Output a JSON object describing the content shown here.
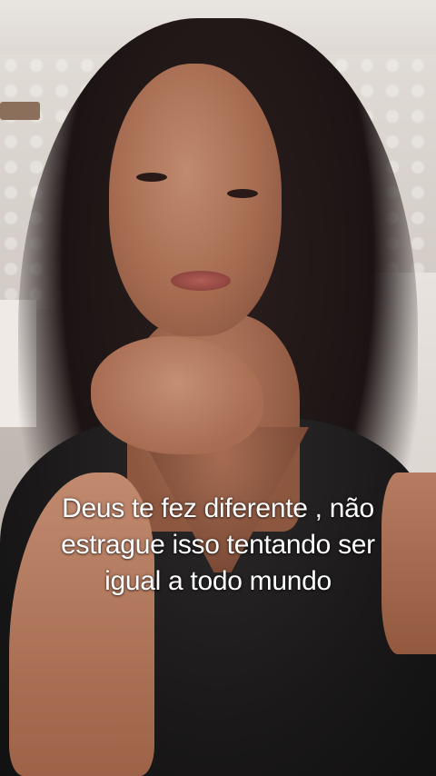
{
  "caption": {
    "lines": [
      "Deus te fez diferente , não",
      "estrague isso tentando ser",
      "igual a todo mundo"
    ]
  }
}
